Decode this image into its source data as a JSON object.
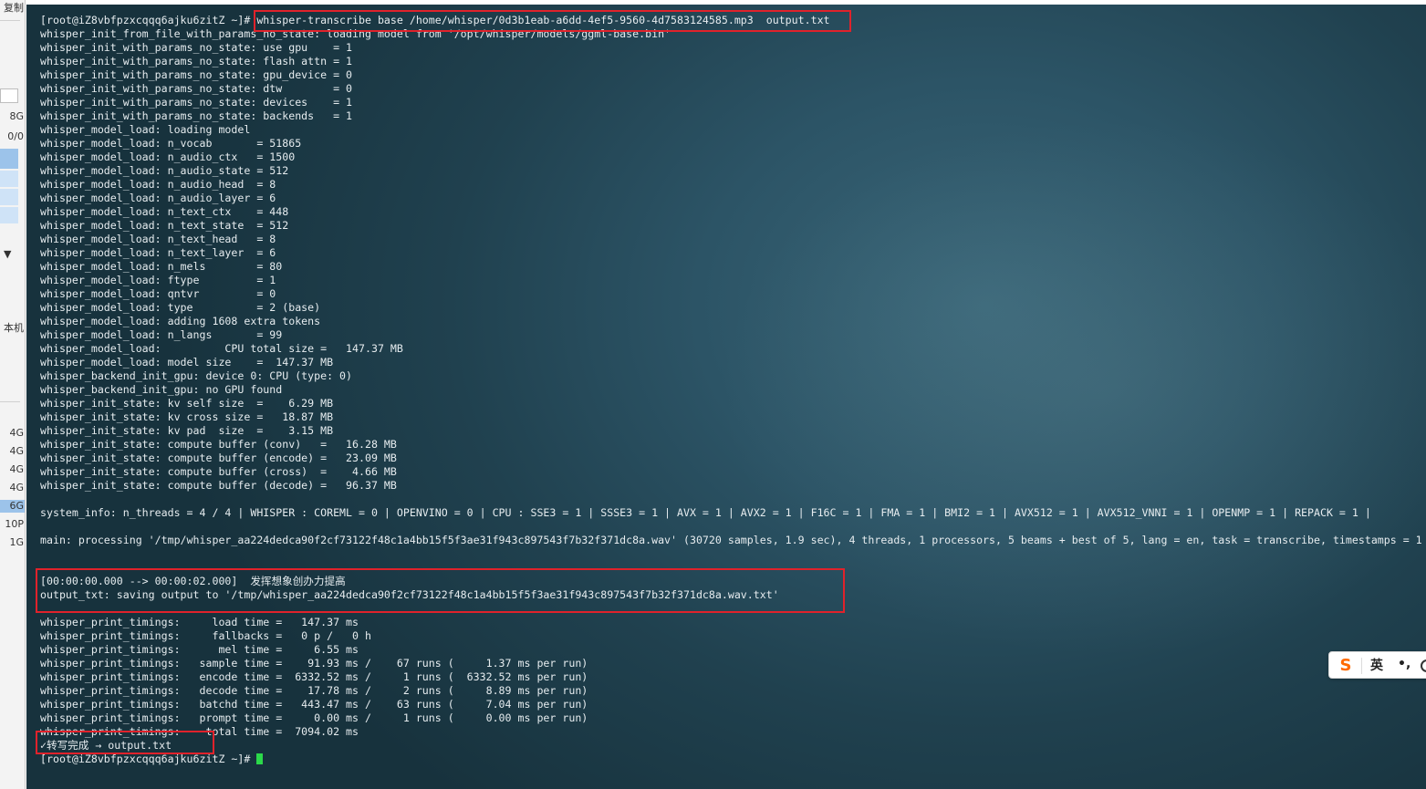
{
  "left_panel": {
    "items": [
      "复制",
      "8G",
      "0/0",
      "本机",
      "4G",
      "4G",
      "4G",
      "4G",
      "6G",
      "10P",
      "1G"
    ]
  },
  "terminal": {
    "prompt": "[root@iZ8vbfpzxcqqq6ajku6zitZ ~]# ",
    "lines": [
      "[root@iZ8vbfpzxcqqq6ajku6zitZ ~]# whisper-transcribe base /home/whisper/0d3b1eab-a6dd-4ef5-9560-4d7583124585.mp3  output.txt",
      "whisper_init_from_file_with_params_no_state: loading model from '/opt/whisper/models/ggml-base.bin'",
      "whisper_init_with_params_no_state: use gpu    = 1",
      "whisper_init_with_params_no_state: flash attn = 1",
      "whisper_init_with_params_no_state: gpu_device = 0",
      "whisper_init_with_params_no_state: dtw        = 0",
      "whisper_init_with_params_no_state: devices    = 1",
      "whisper_init_with_params_no_state: backends   = 1",
      "whisper_model_load: loading model",
      "whisper_model_load: n_vocab       = 51865",
      "whisper_model_load: n_audio_ctx   = 1500",
      "whisper_model_load: n_audio_state = 512",
      "whisper_model_load: n_audio_head  = 8",
      "whisper_model_load: n_audio_layer = 6",
      "whisper_model_load: n_text_ctx    = 448",
      "whisper_model_load: n_text_state  = 512",
      "whisper_model_load: n_text_head   = 8",
      "whisper_model_load: n_text_layer  = 6",
      "whisper_model_load: n_mels        = 80",
      "whisper_model_load: ftype         = 1",
      "whisper_model_load: qntvr         = 0",
      "whisper_model_load: type          = 2 (base)",
      "whisper_model_load: adding 1608 extra tokens",
      "whisper_model_load: n_langs       = 99",
      "whisper_model_load:          CPU total size =   147.37 MB",
      "whisper_model_load: model size    =  147.37 MB",
      "whisper_backend_init_gpu: device 0: CPU (type: 0)",
      "whisper_backend_init_gpu: no GPU found",
      "whisper_init_state: kv self size  =    6.29 MB",
      "whisper_init_state: kv cross size =   18.87 MB",
      "whisper_init_state: kv pad  size  =    3.15 MB",
      "whisper_init_state: compute buffer (conv)   =   16.28 MB",
      "whisper_init_state: compute buffer (encode) =   23.09 MB",
      "whisper_init_state: compute buffer (cross)  =    4.66 MB",
      "whisper_init_state: compute buffer (decode) =   96.37 MB",
      "",
      "system_info: n_threads = 4 / 4 | WHISPER : COREML = 0 | OPENVINO = 0 | CPU : SSE3 = 1 | SSSE3 = 1 | AVX = 1 | AVX2 = 1 | F16C = 1 | FMA = 1 | BMI2 = 1 | AVX512 = 1 | AVX512_VNNI = 1 | OPENMP = 1 | REPACK = 1 |",
      "",
      "main: processing '/tmp/whisper_aa224dedca90f2cf73122f48c1a4bb15f5f3ae31f943c897543f7b32f371dc8a.wav' (30720 samples, 1.9 sec), 4 threads, 1 processors, 5 beams + best of 5, lang = en, task = transcribe, timestamps = 1 ...",
      "",
      "",
      "[00:00:00.000 --> 00:00:02.000]  发挥想象创办力提高",
      "output_txt: saving output to '/tmp/whisper_aa224dedca90f2cf73122f48c1a4bb15f5f3ae31f943c897543f7b32f371dc8a.wav.txt'",
      "",
      "whisper_print_timings:     load time =   147.37 ms",
      "whisper_print_timings:     fallbacks =   0 p /   0 h",
      "whisper_print_timings:      mel time =     6.55 ms",
      "whisper_print_timings:   sample time =    91.93 ms /    67 runs (     1.37 ms per run)",
      "whisper_print_timings:   encode time =  6332.52 ms /     1 runs (  6332.52 ms per run)",
      "whisper_print_timings:   decode time =    17.78 ms /     2 runs (     8.89 ms per run)",
      "whisper_print_timings:   batchd time =   443.47 ms /    63 runs (     7.04 ms per run)",
      "whisper_print_timings:   prompt time =     0.00 ms /     1 runs (     0.00 ms per run)",
      "whisper_print_timings:    total time =  7094.02 ms",
      "✓转写完成 → output.txt"
    ]
  },
  "ime": {
    "logo": "S",
    "lang": "英",
    "punct": "•,"
  },
  "colors": {
    "highlight_border": "#e0222b",
    "cursor": "#2bd94a",
    "terminal_text": "#e6ecef"
  }
}
